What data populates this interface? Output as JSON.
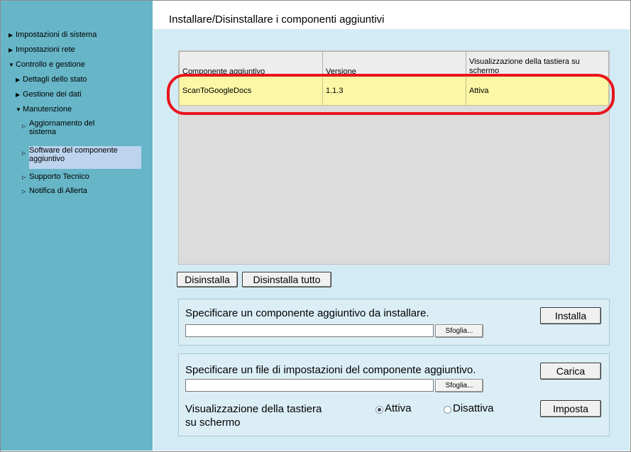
{
  "sidebar": {
    "items": [
      {
        "label": "Impostazioni di sistema"
      },
      {
        "label": "Impostazioni rete"
      },
      {
        "label": "Controllo e gestione"
      },
      {
        "label": "Dettagli dello stato"
      },
      {
        "label": "Gestione dei dati"
      },
      {
        "label": "Manutenzione"
      },
      {
        "label_line1": "Aggiornamento del",
        "label_line2": "sistema"
      },
      {
        "label_line1": "Software del componente",
        "label_line2": "aggiuntivo"
      },
      {
        "label": "Supporto Tecnico"
      },
      {
        "label": "Notifica di Allerta"
      }
    ]
  },
  "main": {
    "title": "Installare/Disinstallare i componenti aggiuntivi",
    "table": {
      "headers": [
        "Componente aggiuntivo",
        "Versione",
        "Visualizzazione della tastiera su schermo"
      ],
      "rows": [
        [
          "ScanToGoogleDocs",
          "1.1.3",
          "Attiva"
        ]
      ]
    },
    "buttons": {
      "uninstall": "Disinstalla",
      "uninstall_all": "Disinstalla tutto"
    },
    "install_section": {
      "label": "Specificare un componente aggiuntivo da installare.",
      "browse": "Sfoglia...",
      "install": "Installa"
    },
    "settings_section": {
      "label": "Specificare un file di impostazioni del componente aggiuntivo.",
      "browse": "Sfoglia...",
      "load": "Carica",
      "keyboard_label_line1": "Visualizzazione della tastiera",
      "keyboard_label_line2": "su schermo",
      "option_on": "Attiva",
      "option_off": "Disattiva",
      "selected": "Attiva",
      "set": "Imposta"
    }
  },
  "colors": {
    "sidebar": "#67b6c8",
    "main_bg": "#d3ebf4",
    "selected_row": "#fbf7a6",
    "highlight": "#e8141c"
  }
}
